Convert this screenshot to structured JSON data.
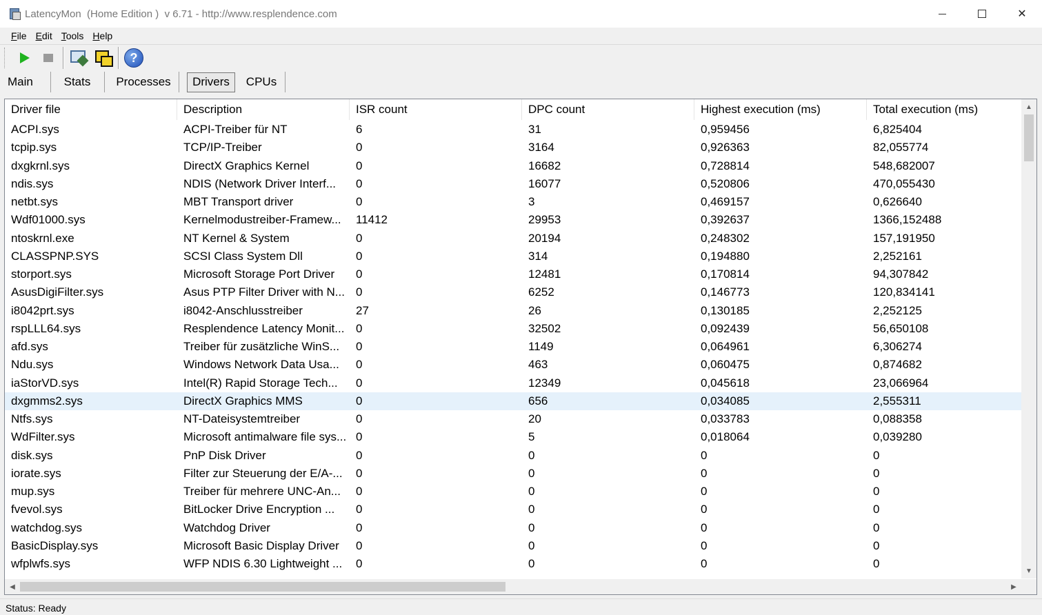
{
  "window": {
    "title": "LatencyMon  (Home Edition )  v 6.71 - http://www.resplendence.com"
  },
  "menu": [
    "File",
    "Edit",
    "Tools",
    "Help"
  ],
  "toolbar": {
    "buttons": [
      {
        "name": "start-icon"
      },
      {
        "name": "stop-icon"
      },
      {
        "name": "analyze-icon"
      },
      {
        "name": "windows-icon"
      },
      {
        "name": "help-icon",
        "glyph": "?"
      }
    ]
  },
  "tabs": [
    "Main",
    "Stats",
    "Processes",
    "Drivers",
    "CPUs"
  ],
  "active_tab": "Drivers",
  "table": {
    "columns": [
      "Driver file",
      "Description",
      "ISR count",
      "DPC count",
      "Highest execution (ms)",
      "Total execution (ms)"
    ],
    "selected_row": 15,
    "rows": [
      [
        "ACPI.sys",
        "ACPI-Treiber für NT",
        "6",
        "31",
        "0,959456",
        "6,825404"
      ],
      [
        "tcpip.sys",
        "TCP/IP-Treiber",
        "0",
        "3164",
        "0,926363",
        "82,055774"
      ],
      [
        "dxgkrnl.sys",
        "DirectX Graphics Kernel",
        "0",
        "16682",
        "0,728814",
        "548,682007"
      ],
      [
        "ndis.sys",
        "NDIS (Network Driver Interf...",
        "0",
        "16077",
        "0,520806",
        "470,055430"
      ],
      [
        "netbt.sys",
        "MBT Transport driver",
        "0",
        "3",
        "0,469157",
        "0,626640"
      ],
      [
        "Wdf01000.sys",
        "Kernelmodustreiber-Framew...",
        "11412",
        "29953",
        "0,392637",
        "1366,152488"
      ],
      [
        "ntoskrnl.exe",
        "NT Kernel & System",
        "0",
        "20194",
        "0,248302",
        "157,191950"
      ],
      [
        "CLASSPNP.SYS",
        "SCSI Class System Dll",
        "0",
        "314",
        "0,194880",
        "2,252161"
      ],
      [
        "storport.sys",
        "Microsoft Storage Port Driver",
        "0",
        "12481",
        "0,170814",
        "94,307842"
      ],
      [
        "AsusDigiFilter.sys",
        "Asus PTP Filter Driver with N...",
        "0",
        "6252",
        "0,146773",
        "120,834141"
      ],
      [
        "i8042prt.sys",
        "i8042-Anschlusstreiber",
        "27",
        "26",
        "0,130185",
        "2,252125"
      ],
      [
        "rspLLL64.sys",
        "Resplendence Latency Monit...",
        "0",
        "32502",
        "0,092439",
        "56,650108"
      ],
      [
        "afd.sys",
        "Treiber für zusätzliche WinS...",
        "0",
        "1149",
        "0,064961",
        "6,306274"
      ],
      [
        "Ndu.sys",
        "Windows Network Data Usa...",
        "0",
        "463",
        "0,060475",
        "0,874682"
      ],
      [
        "iaStorVD.sys",
        "Intel(R) Rapid Storage Tech...",
        "0",
        "12349",
        "0,045618",
        "23,066964"
      ],
      [
        "dxgmms2.sys",
        "DirectX Graphics MMS",
        "0",
        "656",
        "0,034085",
        "2,555311"
      ],
      [
        "Ntfs.sys",
        "NT-Dateisystemtreiber",
        "0",
        "20",
        "0,033783",
        "0,088358"
      ],
      [
        "WdFilter.sys",
        "Microsoft antimalware file sys...",
        "0",
        "5",
        "0,018064",
        "0,039280"
      ],
      [
        "disk.sys",
        "PnP Disk Driver",
        "0",
        "0",
        "0",
        "0"
      ],
      [
        "iorate.sys",
        "Filter zur Steuerung der E/A-...",
        "0",
        "0",
        "0",
        "0"
      ],
      [
        "mup.sys",
        "Treiber für mehrere UNC-An...",
        "0",
        "0",
        "0",
        "0"
      ],
      [
        "fvevol.sys",
        "BitLocker Drive Encryption ...",
        "0",
        "0",
        "0",
        "0"
      ],
      [
        "watchdog.sys",
        "Watchdog Driver",
        "0",
        "0",
        "0",
        "0"
      ],
      [
        "BasicDisplay.sys",
        "Microsoft Basic Display Driver",
        "0",
        "0",
        "0",
        "0"
      ],
      [
        "wfplwfs.sys",
        "WFP NDIS 6.30 Lightweight ...",
        "0",
        "0",
        "0",
        "0"
      ]
    ]
  },
  "status": {
    "text": "Status: Ready"
  }
}
